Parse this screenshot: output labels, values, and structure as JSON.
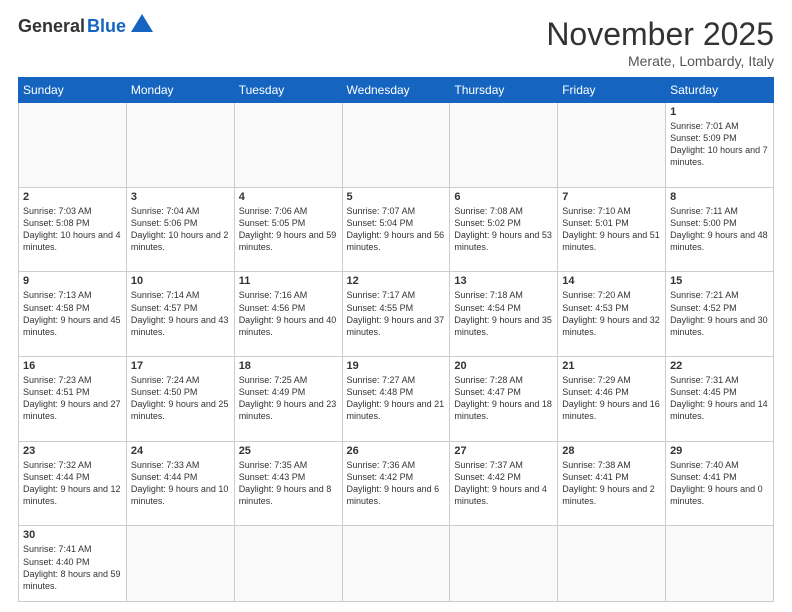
{
  "header": {
    "logo_general": "General",
    "logo_blue": "Blue",
    "month_title": "November 2025",
    "location": "Merate, Lombardy, Italy"
  },
  "weekdays": [
    "Sunday",
    "Monday",
    "Tuesday",
    "Wednesday",
    "Thursday",
    "Friday",
    "Saturday"
  ],
  "weeks": [
    [
      {
        "day": "",
        "info": ""
      },
      {
        "day": "",
        "info": ""
      },
      {
        "day": "",
        "info": ""
      },
      {
        "day": "",
        "info": ""
      },
      {
        "day": "",
        "info": ""
      },
      {
        "day": "",
        "info": ""
      },
      {
        "day": "1",
        "info": "Sunrise: 7:01 AM\nSunset: 5:09 PM\nDaylight: 10 hours and 7 minutes."
      }
    ],
    [
      {
        "day": "2",
        "info": "Sunrise: 7:03 AM\nSunset: 5:08 PM\nDaylight: 10 hours and 4 minutes."
      },
      {
        "day": "3",
        "info": "Sunrise: 7:04 AM\nSunset: 5:06 PM\nDaylight: 10 hours and 2 minutes."
      },
      {
        "day": "4",
        "info": "Sunrise: 7:06 AM\nSunset: 5:05 PM\nDaylight: 9 hours and 59 minutes."
      },
      {
        "day": "5",
        "info": "Sunrise: 7:07 AM\nSunset: 5:04 PM\nDaylight: 9 hours and 56 minutes."
      },
      {
        "day": "6",
        "info": "Sunrise: 7:08 AM\nSunset: 5:02 PM\nDaylight: 9 hours and 53 minutes."
      },
      {
        "day": "7",
        "info": "Sunrise: 7:10 AM\nSunset: 5:01 PM\nDaylight: 9 hours and 51 minutes."
      },
      {
        "day": "8",
        "info": "Sunrise: 7:11 AM\nSunset: 5:00 PM\nDaylight: 9 hours and 48 minutes."
      }
    ],
    [
      {
        "day": "9",
        "info": "Sunrise: 7:13 AM\nSunset: 4:58 PM\nDaylight: 9 hours and 45 minutes."
      },
      {
        "day": "10",
        "info": "Sunrise: 7:14 AM\nSunset: 4:57 PM\nDaylight: 9 hours and 43 minutes."
      },
      {
        "day": "11",
        "info": "Sunrise: 7:16 AM\nSunset: 4:56 PM\nDaylight: 9 hours and 40 minutes."
      },
      {
        "day": "12",
        "info": "Sunrise: 7:17 AM\nSunset: 4:55 PM\nDaylight: 9 hours and 37 minutes."
      },
      {
        "day": "13",
        "info": "Sunrise: 7:18 AM\nSunset: 4:54 PM\nDaylight: 9 hours and 35 minutes."
      },
      {
        "day": "14",
        "info": "Sunrise: 7:20 AM\nSunset: 4:53 PM\nDaylight: 9 hours and 32 minutes."
      },
      {
        "day": "15",
        "info": "Sunrise: 7:21 AM\nSunset: 4:52 PM\nDaylight: 9 hours and 30 minutes."
      }
    ],
    [
      {
        "day": "16",
        "info": "Sunrise: 7:23 AM\nSunset: 4:51 PM\nDaylight: 9 hours and 27 minutes."
      },
      {
        "day": "17",
        "info": "Sunrise: 7:24 AM\nSunset: 4:50 PM\nDaylight: 9 hours and 25 minutes."
      },
      {
        "day": "18",
        "info": "Sunrise: 7:25 AM\nSunset: 4:49 PM\nDaylight: 9 hours and 23 minutes."
      },
      {
        "day": "19",
        "info": "Sunrise: 7:27 AM\nSunset: 4:48 PM\nDaylight: 9 hours and 21 minutes."
      },
      {
        "day": "20",
        "info": "Sunrise: 7:28 AM\nSunset: 4:47 PM\nDaylight: 9 hours and 18 minutes."
      },
      {
        "day": "21",
        "info": "Sunrise: 7:29 AM\nSunset: 4:46 PM\nDaylight: 9 hours and 16 minutes."
      },
      {
        "day": "22",
        "info": "Sunrise: 7:31 AM\nSunset: 4:45 PM\nDaylight: 9 hours and 14 minutes."
      }
    ],
    [
      {
        "day": "23",
        "info": "Sunrise: 7:32 AM\nSunset: 4:44 PM\nDaylight: 9 hours and 12 minutes."
      },
      {
        "day": "24",
        "info": "Sunrise: 7:33 AM\nSunset: 4:44 PM\nDaylight: 9 hours and 10 minutes."
      },
      {
        "day": "25",
        "info": "Sunrise: 7:35 AM\nSunset: 4:43 PM\nDaylight: 9 hours and 8 minutes."
      },
      {
        "day": "26",
        "info": "Sunrise: 7:36 AM\nSunset: 4:42 PM\nDaylight: 9 hours and 6 minutes."
      },
      {
        "day": "27",
        "info": "Sunrise: 7:37 AM\nSunset: 4:42 PM\nDaylight: 9 hours and 4 minutes."
      },
      {
        "day": "28",
        "info": "Sunrise: 7:38 AM\nSunset: 4:41 PM\nDaylight: 9 hours and 2 minutes."
      },
      {
        "day": "29",
        "info": "Sunrise: 7:40 AM\nSunset: 4:41 PM\nDaylight: 9 hours and 0 minutes."
      }
    ],
    [
      {
        "day": "30",
        "info": "Sunrise: 7:41 AM\nSunset: 4:40 PM\nDaylight: 8 hours and 59 minutes."
      },
      {
        "day": "",
        "info": ""
      },
      {
        "day": "",
        "info": ""
      },
      {
        "day": "",
        "info": ""
      },
      {
        "day": "",
        "info": ""
      },
      {
        "day": "",
        "info": ""
      },
      {
        "day": "",
        "info": ""
      }
    ]
  ]
}
